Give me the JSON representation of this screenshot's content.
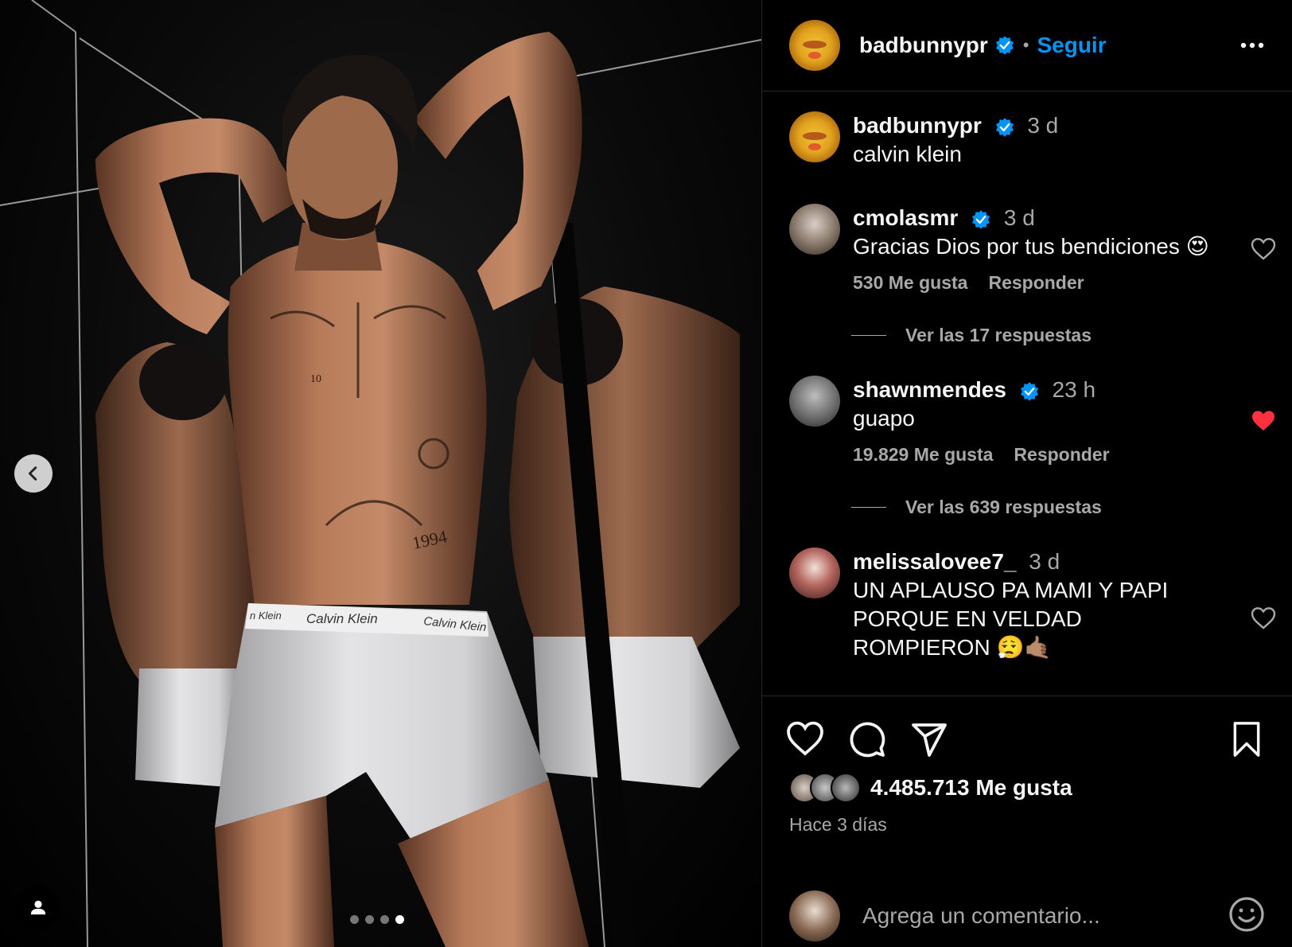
{
  "post": {
    "author": "badbunnypr",
    "follow_label": "Seguir",
    "separator": "•",
    "caption_author": "badbunnypr",
    "caption_time": "3 d",
    "caption": "calvin klein",
    "carousel": {
      "total": 4,
      "active": 4
    },
    "image_text": {
      "brand_band_1": "Calvin Klein",
      "brand_band_2": "Calvin Klein",
      "brand_band_0": "n Klein",
      "tattoo_year": "1994",
      "tattoo_num": "10"
    }
  },
  "comments": [
    {
      "user": "cmolasmr",
      "verified": true,
      "time": "3 d",
      "text": "Gracias Dios por tus bendiciones 😍",
      "likes": "530 Me gusta",
      "reply": "Responder",
      "replies_label": "Ver las 17 respuestas",
      "liked": false
    },
    {
      "user": "shawnmendes",
      "verified": true,
      "time": "23 h",
      "text": "guapo",
      "likes": "19.829 Me gusta",
      "reply": "Responder",
      "replies_label": "Ver las 639 respuestas",
      "liked": true
    },
    {
      "user": "melissalovee7_",
      "verified": false,
      "time": "3 d",
      "text": "UN APLAUSO PA MAMI Y PAPI PORQUE EN VELDAD ROMPIERON 😮‍💨🤙🏽",
      "liked": false
    }
  ],
  "footer": {
    "likes_count": "4.485.713 Me gusta",
    "ago": "Hace 3 días",
    "comment_placeholder": "Agrega un comentario..."
  },
  "icons": [
    "chevron-left-icon",
    "user-tag-icon",
    "more-icon",
    "verified-icon",
    "heart-icon",
    "comment-icon",
    "share-icon",
    "bookmark-icon",
    "emoji-icon"
  ],
  "colors": {
    "accent": "#0095f6",
    "liked": "#ff3040",
    "muted": "#a8a8a8",
    "verified": "#0095f6"
  }
}
